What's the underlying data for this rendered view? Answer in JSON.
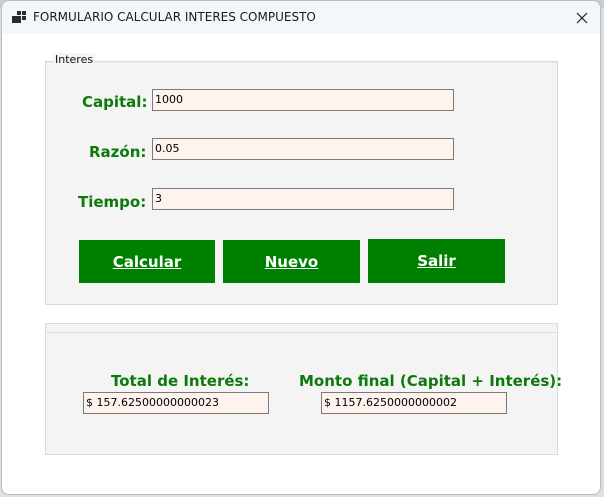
{
  "window": {
    "title": "FORMULARIO CALCULAR INTERES COMPUESTO",
    "close_glyph": "✕"
  },
  "interes_group": {
    "legend": "Interes",
    "capital_label": "Capital:",
    "capital_value": "1000",
    "razon_label": "Razón:",
    "razon_value": "0.05",
    "tiempo_label": "Tiempo:",
    "tiempo_value": "3"
  },
  "buttons": {
    "calcular": "Calcular",
    "nuevo": "Nuevo",
    "salir": "Salir"
  },
  "results_group": {
    "total_label": "Total de Interés:",
    "total_value": "$ 157.62500000000023",
    "monto_label": "Monto final  (Capital + Interés):",
    "monto_value": "$ 1157.6250000000002"
  },
  "colors": {
    "accent_green": "#008000",
    "label_green": "#0b7a0b",
    "field_background": "#fff3ee",
    "group_background": "#f4f4f4"
  },
  "icons": {
    "app": "form-app-icon",
    "close": "close-icon"
  }
}
